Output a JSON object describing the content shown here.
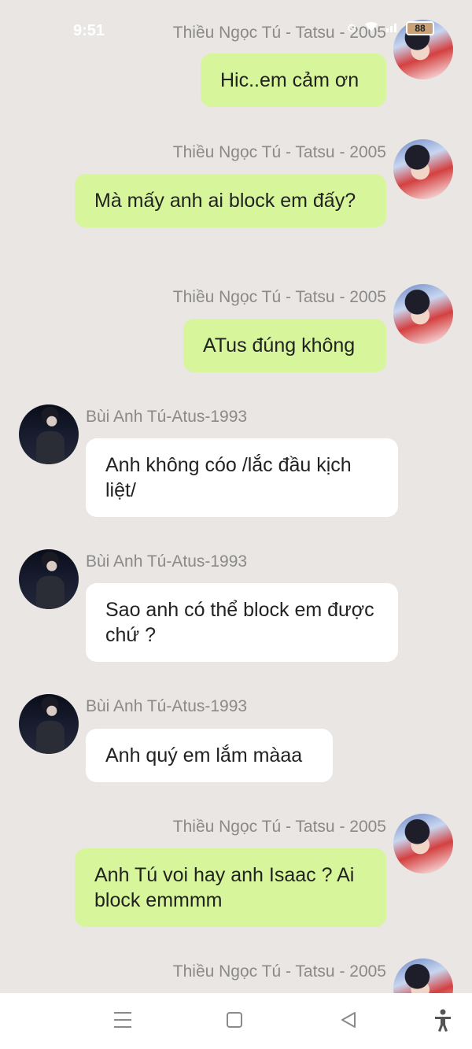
{
  "status_bar": {
    "time": "9:51",
    "battery": "88"
  },
  "contacts": {
    "her": "Thiều Ngọc Tú - Tatsu - 2005",
    "him": "Bùi Anh Tú-Atus-1993"
  },
  "messages": [
    {
      "sender": "Thiều Ngọc Tú - Tatsu - 2005",
      "text": "Hic..em cảm ơn"
    },
    {
      "sender": "Thiều Ngọc Tú - Tatsu - 2005",
      "text": "Mà mấy anh ai block em đấy?"
    },
    {
      "sender": "Thiều Ngọc Tú - Tatsu - 2005",
      "text": "ATus đúng không"
    },
    {
      "sender": "Bùi Anh Tú-Atus-1993",
      "text": "Anh không cóo /lắc đầu kịch liệt/"
    },
    {
      "sender": "Bùi Anh Tú-Atus-1993",
      "text": "Sao anh có thể block em được chứ ?"
    },
    {
      "sender": "Bùi Anh Tú-Atus-1993",
      "text": "Anh quý em lắm màaa"
    },
    {
      "sender": "Thiều Ngọc Tú - Tatsu - 2005",
      "text": "Anh Tú voi hay anh Isaac ? Ai block emmmm"
    },
    {
      "sender": "Thiều Ngọc Tú - Tatsu - 2005",
      "text": ""
    }
  ],
  "nav": {
    "icons": [
      "menu-icon",
      "home-icon",
      "back-icon",
      "accessibility-icon"
    ]
  }
}
